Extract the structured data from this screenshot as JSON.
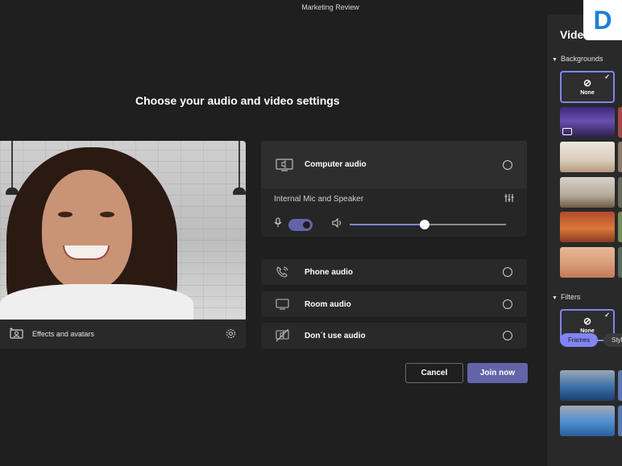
{
  "window": {
    "title": "Marketing Review"
  },
  "prejoin": {
    "heading": "Choose your audio and video settings"
  },
  "video": {
    "effects_label": "Effects and avatars",
    "icons": {
      "effects": "effects-icon",
      "settings": "gear-icon"
    }
  },
  "audio": {
    "computer": {
      "label": "Computer audio",
      "device": "Internal Mic and Speaker",
      "mic_on": true,
      "volume": 0.48
    },
    "phone": {
      "label": "Phone audio"
    },
    "room": {
      "label": "Room audio"
    },
    "none": {
      "label": "Don´t use audio"
    }
  },
  "buttons": {
    "cancel": "Cancel",
    "join": "Join now"
  },
  "side_panel": {
    "title": "Vide",
    "backgrounds_label": "Backgrounds",
    "backgrounds_none": "None",
    "filters_label": "Filters",
    "filters_none": "None",
    "chips": [
      "Frames",
      "Styl"
    ]
  },
  "brand": {
    "logo_letter": "D"
  },
  "colors": {
    "accent": "#6264a7",
    "accent_light": "#7f85f5",
    "background": "#1f1f1f"
  }
}
